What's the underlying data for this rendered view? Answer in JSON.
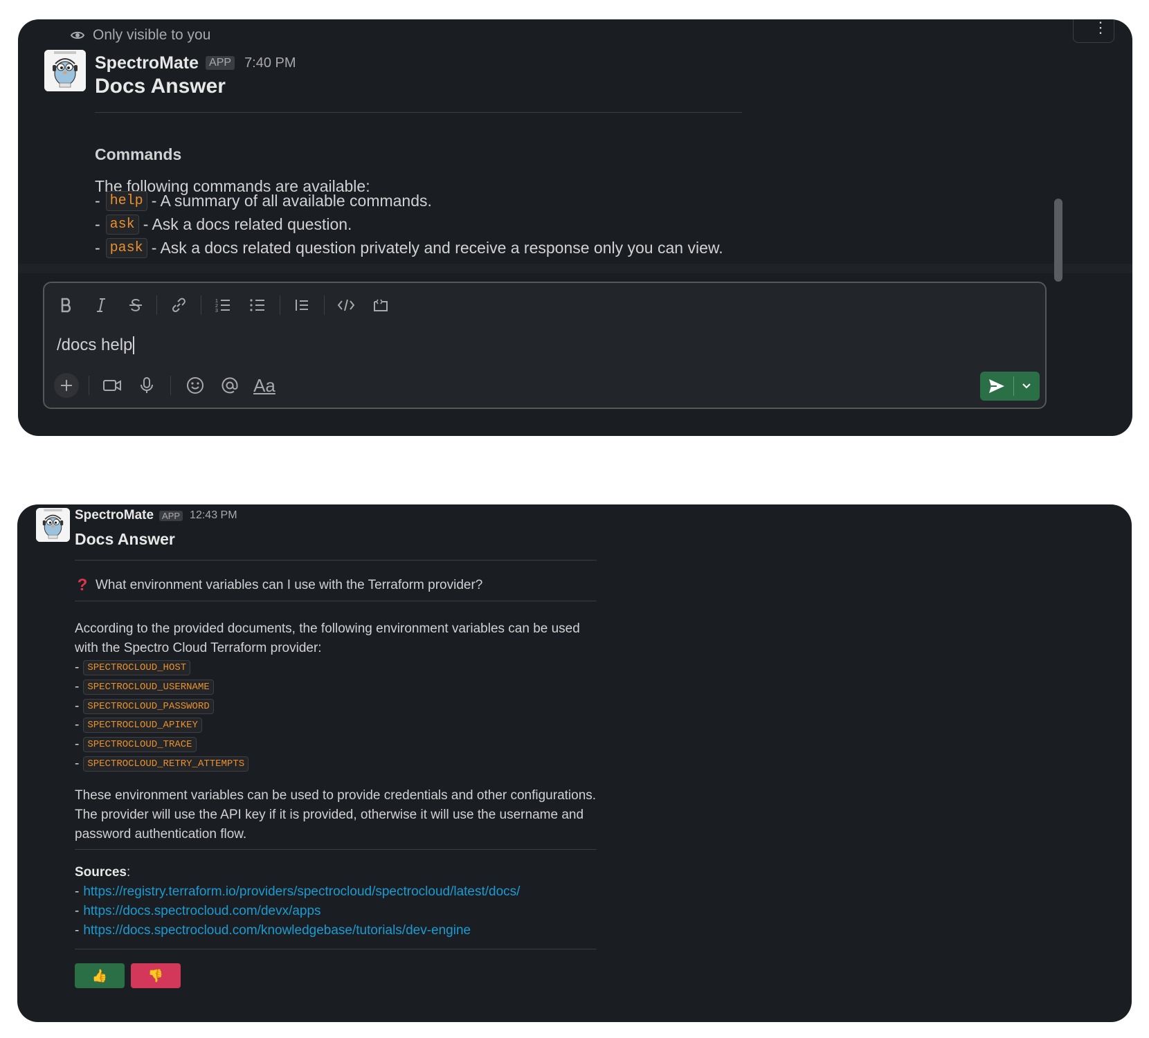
{
  "panel1": {
    "visibility_note": "Only visible to you",
    "sender": "SpectroMate",
    "badge": "APP",
    "time": "7:40 PM",
    "title": "Docs Answer",
    "section_heading": "Commands",
    "intro": "The following commands are available:",
    "commands": [
      {
        "bullet": "-",
        "code": "help",
        "text": "- A summary of all available commands."
      },
      {
        "bullet": "-",
        "code": "ask",
        "text": "- Ask a docs related question."
      },
      {
        "bullet": "-",
        "code": "pask",
        "text": "- Ask a docs related question privately and receive a response only you can view."
      }
    ],
    "composer": {
      "text": "/docs help",
      "format_label": "Aa",
      "toolbar_icons": [
        "bold-icon",
        "italic-icon",
        "strikethrough-icon",
        "link-icon",
        "ordered-list-icon",
        "bulleted-list-icon",
        "blockquote-icon",
        "code-icon",
        "code-block-icon"
      ],
      "bottom_icons": [
        "plus-icon",
        "video-icon",
        "microphone-icon",
        "emoji-icon",
        "mention-icon",
        "format-icon"
      ]
    }
  },
  "panel2": {
    "sender": "SpectroMate",
    "badge": "APP",
    "time": "12:43 PM",
    "title": "Docs Answer",
    "question": "What environment variables can I use with the Terraform provider?",
    "answer_intro": "According to the provided documents, the following environment variables can be used with the Spectro Cloud Terraform provider:",
    "env_vars": [
      "SPECTROCLOUD_HOST",
      "SPECTROCLOUD_USERNAME",
      "SPECTROCLOUD_PASSWORD",
      "SPECTROCLOUD_APIKEY",
      "SPECTROCLOUD_TRACE",
      "SPECTROCLOUD_RETRY_ATTEMPTS"
    ],
    "bullet": "-",
    "answer_outro": "These environment variables can be used to provide credentials and other configurations. The provider will use the API key if it is provided, otherwise it will use the username and password authentication flow.",
    "sources_label": "Sources",
    "sources_colon": ":",
    "sources": [
      "https://registry.terraform.io/providers/spectrocloud/spectrocloud/latest/docs/",
      "https://docs.spectrocloud.com/devx/apps",
      "https://docs.spectrocloud.com/knowledgebase/tutorials/dev-engine"
    ],
    "vote_up": "👍",
    "vote_down": "👎"
  },
  "colors": {
    "panel_bg": "#1a1d21",
    "code_fg": "#e8912d",
    "link": "#1d9bd1",
    "send_green": "#2a6f46",
    "thumbs_down_red": "#d3385b",
    "question_red": "#e0354b"
  }
}
